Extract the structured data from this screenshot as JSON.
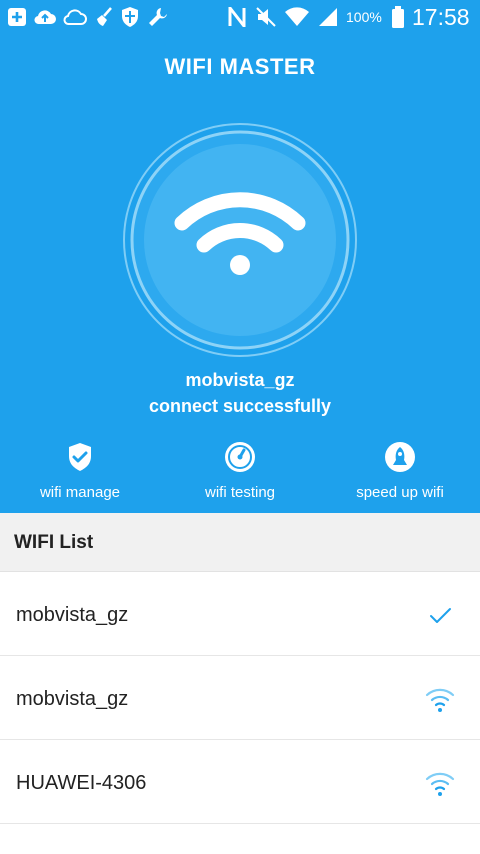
{
  "status_bar": {
    "battery_percent": "100%",
    "time": "17:58",
    "icons": [
      "plus-box-icon",
      "cloud-upload-icon",
      "cloud-icon",
      "broom-icon",
      "shield-icon",
      "wrench-icon",
      "nfc-icon",
      "mute-icon",
      "wifi-signal-icon",
      "cell-signal-icon",
      "battery-icon"
    ]
  },
  "app": {
    "title": "WIFI MASTER",
    "accent_color": "#1ea1ec"
  },
  "connection": {
    "ssid": "mobvista_gz",
    "status": "connect successfully",
    "icon": "wifi-icon"
  },
  "actions": [
    {
      "label": "wifi manage",
      "icon": "shield-check-icon"
    },
    {
      "label": "wifi testing",
      "icon": "speedometer-icon"
    },
    {
      "label": "speed up wifi",
      "icon": "rocket-icon"
    }
  ],
  "wifi_list": {
    "title": "WIFI List",
    "items": [
      {
        "name": "mobvista_gz",
        "state": "connected",
        "icon": "checkmark-icon"
      },
      {
        "name": "mobvista_gz",
        "state": "available",
        "icon": "wifi-signal-icon"
      },
      {
        "name": "HUAWEI-4306",
        "state": "available",
        "icon": "wifi-signal-icon"
      }
    ]
  }
}
